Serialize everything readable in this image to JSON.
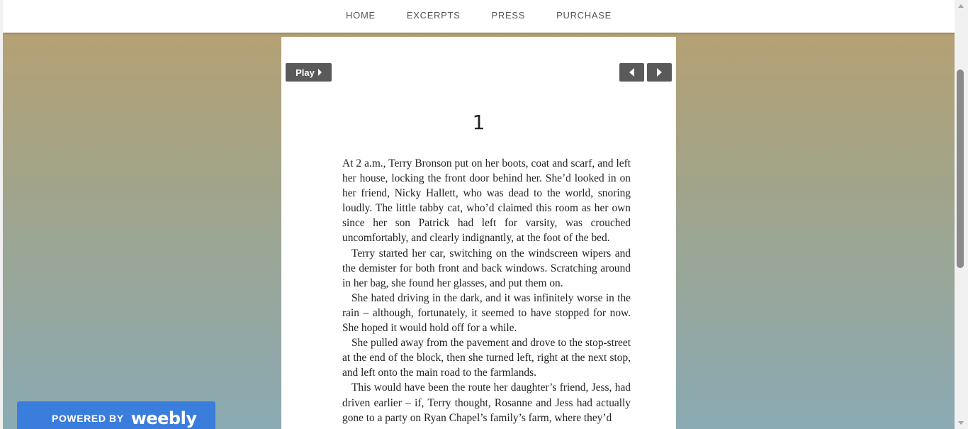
{
  "nav": {
    "items": [
      {
        "label": "HOME"
      },
      {
        "label": "EXCERPTS"
      },
      {
        "label": "PRESS"
      },
      {
        "label": "PURCHASE"
      }
    ]
  },
  "viewer": {
    "play_label": "Play",
    "prev_icon": "caret-left-icon",
    "next_icon": "caret-right-icon"
  },
  "book": {
    "chapter": "1",
    "lines": [
      "At 2 a.m., Terry Bronson put on her boots, coat and scarf, and left her house, locking the front door behind her. She’d looked in on her friend, Nicky Hallett, who was dead to the world, snoring loudly. The little tabby cat, who’d claimed this room as her own since her son Patrick had left for varsity, was crouched uncomfortably, and clearly indignantly, at the foot of the bed.",
      "Terry started her car, switching on the windscreen wipers and the demister for both front and back windows. Scratching around in her bag, she found her glasses, and put them on.",
      "She hated driving in the dark, and it was infinitely worse in the rain – although, fortunately, it seemed to have stopped for now. She hoped it would hold off for a while.",
      "She pulled away from the pavement and drove to the stop-street at the end of the block, then she turned left, right at the next stop, and left onto the main road to the farmlands.",
      "This would have been the route her daughter’s friend, Jess, had driven earlier – if, Terry thought, Rosanne and Jess had actually gone to a party on Ryan Chapel’s family’s farm, where they’d"
    ]
  },
  "footer": {
    "powered_by": "POWERED BY",
    "brand": "weebly"
  },
  "colors": {
    "bg_top": "#b9a070",
    "bg_bottom": "#8aaab4",
    "button": "#5a5a5a",
    "weebly_blue": "#3b7ddd"
  }
}
